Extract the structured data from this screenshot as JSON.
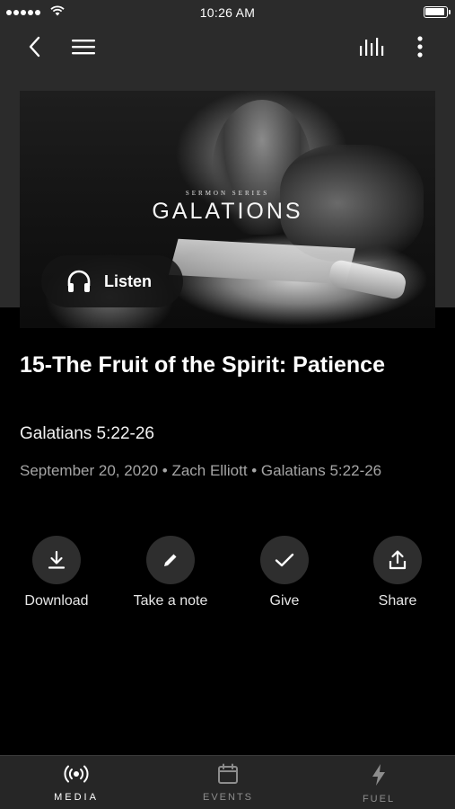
{
  "status_bar": {
    "time": "10:26 AM"
  },
  "nav": {
    "back_icon": "chevron-left-icon",
    "menu_icon": "hamburger-menu-icon",
    "audio_icon": "audio-bars-icon",
    "more_icon": "more-vertical-icon"
  },
  "hero": {
    "series_label": "SERMON SERIES",
    "series_title": "GALATIONS",
    "listen_label": "Listen",
    "listen_icon": "headphones-icon"
  },
  "sermon": {
    "title": "15-The Fruit of the Spirit: Patience",
    "scripture": "Galatians 5:22-26",
    "meta": "September 20, 2020 • Zach Elliott • Galatians 5:22-26"
  },
  "actions": [
    {
      "label": "Download",
      "icon": "download-icon"
    },
    {
      "label": "Take a note",
      "icon": "pencil-icon"
    },
    {
      "label": "Give",
      "icon": "checkmark-icon"
    },
    {
      "label": "Share",
      "icon": "share-icon"
    }
  ],
  "tabs": [
    {
      "label": "MEDIA",
      "icon": "broadcast-icon",
      "active": true
    },
    {
      "label": "EVENTS",
      "icon": "calendar-icon",
      "active": false
    },
    {
      "label": "FUEL",
      "icon": "lightning-icon",
      "active": false
    }
  ]
}
